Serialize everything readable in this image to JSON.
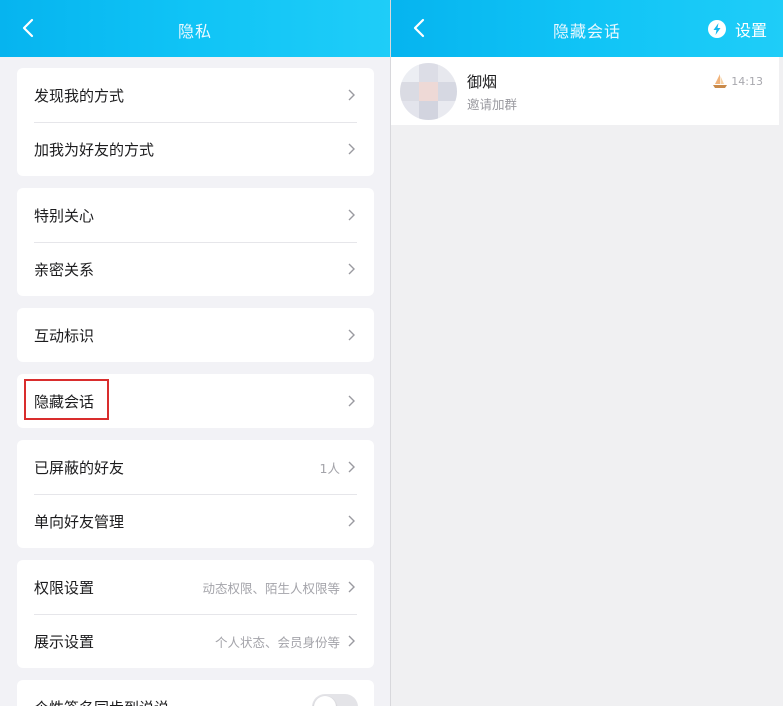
{
  "left_panel": {
    "title": "隐私",
    "groups": [
      {
        "items": [
          {
            "label": "发现我的方式"
          },
          {
            "label": "加我为好友的方式"
          }
        ]
      },
      {
        "items": [
          {
            "label": "特别关心"
          },
          {
            "label": "亲密关系"
          }
        ]
      },
      {
        "items": [
          {
            "label": "互动标识"
          }
        ]
      },
      {
        "items": [
          {
            "label": "隐藏会话",
            "highlighted": true
          }
        ]
      },
      {
        "items": [
          {
            "label": "已屏蔽的好友",
            "value": "1人"
          },
          {
            "label": "单向好友管理"
          }
        ]
      },
      {
        "items": [
          {
            "label": "权限设置",
            "value": "动态权限、陌生人权限等"
          },
          {
            "label": "展示设置",
            "value": "个人状态、会员身份等"
          }
        ]
      },
      {
        "items": [
          {
            "label": "个性签名同步到说说",
            "toggle": false
          }
        ]
      }
    ]
  },
  "right_panel": {
    "title": "隐藏会话",
    "settings_label": "设置",
    "conversations": [
      {
        "name": "御烟",
        "preview": "邀请加群",
        "time": "14:13",
        "icon": "boat-icon"
      }
    ]
  },
  "colors": {
    "header_gradient_start": "#06b4ef",
    "header_gradient_end": "#1fcdf8",
    "highlight_border": "#d92d2d"
  }
}
